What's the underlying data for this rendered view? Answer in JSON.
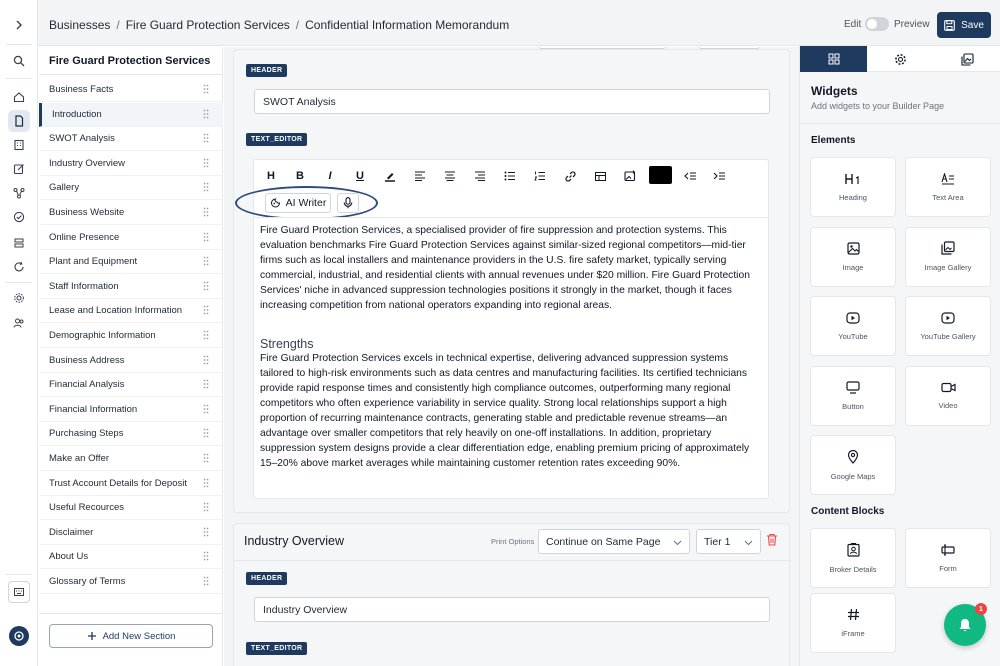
{
  "breadcrumb": [
    "Businesses",
    "Fire Guard Protection Services",
    "Confidential Information Memorandum"
  ],
  "top_actions": {
    "edit_label": "Edit",
    "preview_label": "Preview",
    "save_label": "Save"
  },
  "sidebar": {
    "title": "Fire Guard Protection Services",
    "items": [
      "Business Facts",
      "Introduction",
      "SWOT Analysis",
      "Industry Overview",
      "Gallery",
      "Business Website",
      "Online Presence",
      "Plant and Equipment",
      "Staff Information",
      "Lease and Location Information",
      "Demographic Information",
      "Business Address",
      "Financial Analysis",
      "Financial Information",
      "Purchasing Steps",
      "Make an Offer",
      "Trust Account Details for Deposit",
      "Useful Recources",
      "Disclaimer",
      "About Us",
      "Glossary of Terms"
    ],
    "active_item": "Introduction",
    "add_section_label": "Add New Section"
  },
  "swot_block": {
    "header_tag": "HEADER",
    "header_value": "SWOT Analysis",
    "editor_tag": "TEXT_EDITOR",
    "ai_writer_label": "AI Writer",
    "text_color": "#000000",
    "intro_paragraph": "Fire Guard Protection Services, a specialised provider of fire suppression and protection systems. This evaluation benchmarks Fire Guard Protection Services against similar-sized regional competitors—mid-tier firms such as local installers and maintenance providers in the U.S. fire safety market, typically serving commercial, industrial, and residential clients with annual revenues under $20 million. Fire Guard Protection Services' niche in advanced suppression technologies positions it strongly in the market, though it faces increasing competition from national operators expanding into regional areas.",
    "strengths_heading": "Strengths",
    "strengths_paragraph": "Fire Guard Protection Services excels in technical expertise, delivering advanced suppression systems tailored to high-risk environments such as data centres and manufacturing facilities. Its certified technicians provide rapid response times and consistently high compliance outcomes, outperforming many regional competitors who often experience variability in service quality. Strong local relationships support a high proportion of recurring maintenance contracts, generating stable and predictable revenue streams—an advantage over smaller competitors that rely heavily on one-off installations. In addition, proprietary suppression system designs provide a clear differentiation edge, enabling premium pricing of approximately 15–20% above market averages while maintaining customer retention rates exceeding 90%."
  },
  "industry_block": {
    "title": "Industry Overview",
    "print_options_label": "Print Options",
    "print_option_value": "Continue on Same Page",
    "tier_value": "Tier 1",
    "header_tag": "HEADER",
    "header_value": "Industry Overview",
    "editor_tag": "TEXT_EDITOR"
  },
  "widgets_panel": {
    "title": "Widgets",
    "subtitle": "Add widgets to your Builder Page",
    "elements_heading": "Elements",
    "elements": [
      {
        "label": "Heading",
        "icon": "heading-icon"
      },
      {
        "label": "Text Area",
        "icon": "text-area-icon"
      },
      {
        "label": "Image",
        "icon": "image-icon"
      },
      {
        "label": "Image Gallery",
        "icon": "image-gallery-icon"
      },
      {
        "label": "YouTube",
        "icon": "youtube-icon"
      },
      {
        "label": "YouTube Gallery",
        "icon": "youtube-gallery-icon"
      },
      {
        "label": "Button",
        "icon": "button-icon"
      },
      {
        "label": "Video",
        "icon": "video-icon"
      },
      {
        "label": "Google Maps",
        "icon": "map-pin-icon"
      }
    ],
    "content_blocks_heading": "Content Blocks",
    "content_blocks": [
      {
        "label": "Broker Details",
        "icon": "broker-details-icon"
      },
      {
        "label": "Form",
        "icon": "form-icon"
      },
      {
        "label": "iFrame",
        "icon": "iframe-icon"
      }
    ]
  },
  "notification_count": "1",
  "colors": {
    "primary": "#1e3a5f",
    "accent": "#10b981",
    "badge": "#ef4444",
    "delete": "#ef4444"
  }
}
